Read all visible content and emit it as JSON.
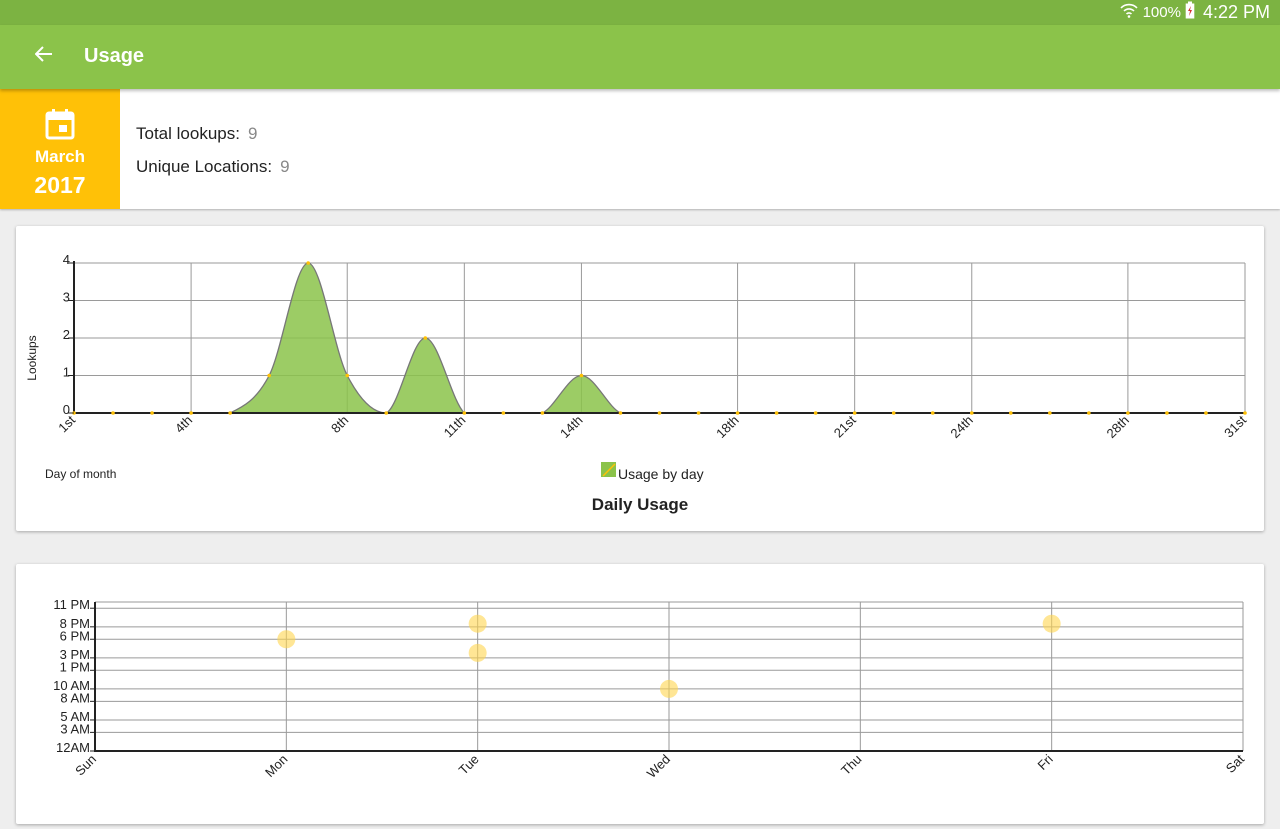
{
  "status_bar": {
    "battery_percent": "100%",
    "time": "4:22 PM",
    "icons": [
      "wifi-icon",
      "battery-charging-icon"
    ]
  },
  "app_bar": {
    "title": "Usage",
    "back_icon": "arrow-back-icon"
  },
  "summary": {
    "month": "March",
    "year": "2017",
    "calendar_icon": "calendar-icon",
    "total_lookups_label": "Total lookups:",
    "total_lookups_value": "9",
    "unique_locations_label": "Unique Locations:",
    "unique_locations_value": "9"
  },
  "colors": {
    "status_bar": "#7cb342",
    "app_bar": "#8bc34a",
    "date_tile": "#ffc107",
    "area_fill": "#8bc34a",
    "point": "#ffc107",
    "bubble": "#ffd54f"
  },
  "chart_data": [
    {
      "type": "area",
      "title": "Daily Usage",
      "xlabel": "Day of month",
      "ylabel": "Lookups",
      "legend": "Usage by day",
      "legend_position": "bottom-center",
      "x_ticks": [
        "1st",
        "4th",
        "8th",
        "11th",
        "14th",
        "18th",
        "21st",
        "24th",
        "28th",
        "31st"
      ],
      "y_ticks": [
        "0",
        "1",
        "2",
        "3",
        "4"
      ],
      "ylim": [
        0,
        4
      ],
      "xlim": [
        1,
        31
      ],
      "grid": true,
      "series": [
        {
          "name": "Usage by day",
          "x": [
            1,
            2,
            3,
            4,
            5,
            6,
            7,
            8,
            9,
            10,
            11,
            12,
            13,
            14,
            15,
            16,
            17,
            18,
            19,
            20,
            21,
            22,
            23,
            24,
            25,
            26,
            27,
            28,
            29,
            30,
            31
          ],
          "values": [
            0,
            0,
            0,
            0,
            0,
            1,
            4,
            1,
            0,
            2,
            0,
            0,
            0,
            1,
            0,
            0,
            0,
            0,
            0,
            0,
            0,
            0,
            0,
            0,
            0,
            0,
            0,
            0,
            0,
            0,
            0
          ]
        }
      ]
    },
    {
      "type": "scatter",
      "title": "",
      "x_ticks": [
        "Sun",
        "Mon",
        "Tue",
        "Wed",
        "Thu",
        "Fri",
        "Sat"
      ],
      "y_ticks": [
        "12AM",
        "3 AM",
        "5 AM",
        "8 AM",
        "10 AM",
        "1 PM",
        "3 PM",
        "6 PM",
        "8 PM",
        "11 PM"
      ],
      "grid": true,
      "points": [
        {
          "day": "Mon",
          "hour": 18
        },
        {
          "day": "Tue",
          "hour": 20.5
        },
        {
          "day": "Tue",
          "hour": 15.8
        },
        {
          "day": "Wed",
          "hour": 10
        },
        {
          "day": "Fri",
          "hour": 20.5
        }
      ]
    }
  ]
}
